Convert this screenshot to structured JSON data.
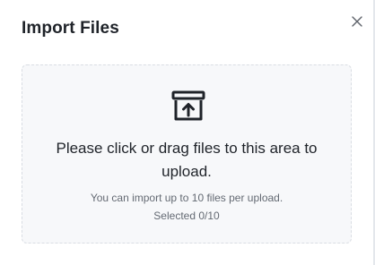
{
  "dialog": {
    "title": "Import Files",
    "close_icon": "close-icon"
  },
  "dropzone": {
    "icon": "upload-archive-icon",
    "primary_text": "Please click or drag files to this area to upload.",
    "hint_text": "You can import up to 10 files per upload.",
    "selected_text": "Selected 0/10"
  }
}
